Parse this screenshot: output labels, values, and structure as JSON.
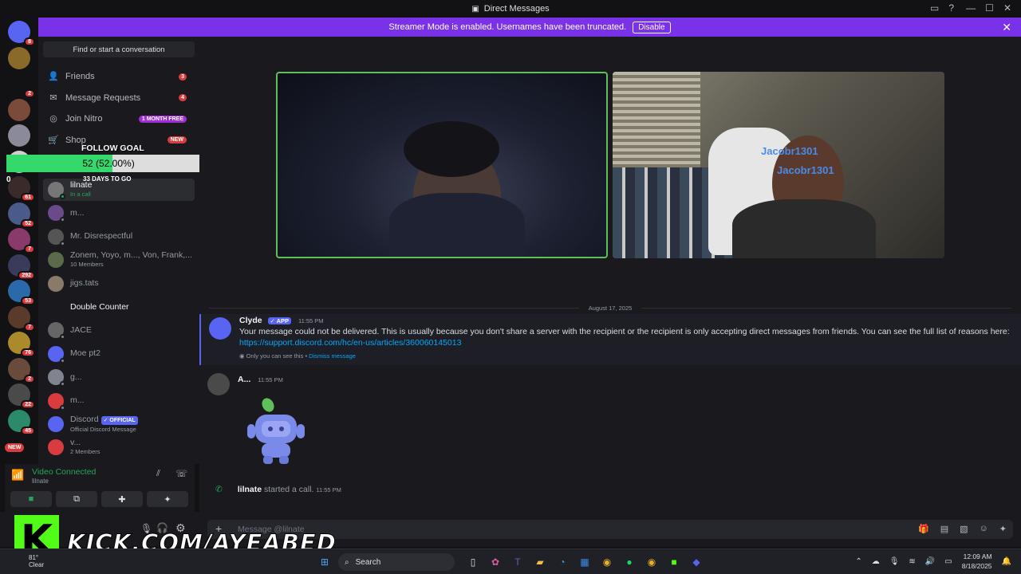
{
  "window": {
    "title": "Direct Messages"
  },
  "banner": {
    "text": "Streamer Mode is enabled. Usernames have been truncated.",
    "button": "Disable"
  },
  "servers": [
    {
      "badge": "8",
      "color": "#5865f2"
    },
    {
      "badge": "",
      "color": "#8a6a2a"
    },
    {
      "badge": "2",
      "color": "#121214"
    },
    {
      "badge": "",
      "color": "#7a4a3a"
    },
    {
      "badge": "",
      "color": "#8a8a9a"
    },
    {
      "badge": "",
      "color": "#cfcfcf"
    },
    {
      "badge": "61",
      "color": "#3a2a2a"
    },
    {
      "badge": "52",
      "color": "#4a5a8a"
    },
    {
      "badge": "7",
      "color": "#8a3a6a"
    },
    {
      "badge": "292",
      "color": "#3a3a5a"
    },
    {
      "badge": "53",
      "color": "#2a6aaa"
    },
    {
      "badge": "7",
      "color": "#5a3a2a"
    },
    {
      "badge": "76",
      "color": "#aa8a2a"
    },
    {
      "badge": "2",
      "color": "#6a4a3a"
    },
    {
      "badge": "22",
      "color": "#4a4a4a"
    },
    {
      "badge": "45",
      "color": "#2a8a6a"
    }
  ],
  "servers_new": "NEW",
  "sidebar": {
    "find": "Find or start a conversation",
    "nav": [
      {
        "label": "Friends",
        "badge": "3",
        "icon": "friends-icon"
      },
      {
        "label": "Message Requests",
        "badge": "4",
        "icon": "mail-icon"
      },
      {
        "label": "Join Nitro",
        "badge": "1 MONTH FREE",
        "icon": "nitro-icon"
      },
      {
        "label": "Shop",
        "badge": "NEW",
        "icon": "shop-icon"
      }
    ],
    "dms": [
      {
        "name": "lilnate",
        "sub": "In a call",
        "color": "#777",
        "status": "#23a55a"
      },
      {
        "name": "m...",
        "sub": "",
        "color": "#6a4a8a",
        "status": "#80848e"
      },
      {
        "name": "Mr. Disrespectful",
        "sub": "",
        "color": "#555",
        "status": "#80848e"
      },
      {
        "name": "Zonem, Yoyo, m..., Von, Frank,...",
        "sub": "10 Members",
        "color": "#5a6a4a",
        "status": ""
      },
      {
        "name": "jigs.tats",
        "sub": "",
        "color": "#8a7a6a",
        "status": ""
      },
      {
        "name": "Double Counter",
        "sub": "",
        "color": "#1a1a1e",
        "status": ""
      },
      {
        "name": "JACE",
        "sub": "",
        "color": "#666",
        "status": "#80848e"
      },
      {
        "name": "Moe pt2",
        "sub": "",
        "color": "#5865f2",
        "status": "#80848e"
      },
      {
        "name": "g...",
        "sub": "",
        "color": "#80848e",
        "status": "#80848e"
      },
      {
        "name": "m...",
        "sub": "",
        "color": "#d83c3e",
        "status": "#80848e"
      },
      {
        "name": "Discord",
        "sub": "Official Discord Message",
        "color": "#5865f2",
        "status": "",
        "tag": "OFFICIAL"
      },
      {
        "name": "v...",
        "sub": "2 Members",
        "color": "#d83c3e",
        "status": ""
      }
    ]
  },
  "follow_goal": {
    "title": "FOLLOW GOAL",
    "value": "52 (52.00%)",
    "progress": 0.52,
    "min": "0",
    "max": "100",
    "days": "33 DAYS TO GO"
  },
  "voice": {
    "status": "Video Connected",
    "user": "lilnate"
  },
  "call": {
    "overlay1": "Jacobr1301",
    "overlay2": "Jacobr1301"
  },
  "chat": {
    "date": "August 17, 2025",
    "messages": [
      {
        "author": "Clyde",
        "tag": "APP",
        "time": "11:55 PM",
        "text": "Your message could not be delivered. This is usually because you don't share a server with the recipient or the recipient is only accepting direct messages from friends. You can see the full list of reasons here:",
        "link": "https://support.discord.com/hc/en-us/articles/360060145013",
        "note": "Only you can see this",
        "dismiss": "Dismiss message"
      },
      {
        "author": "A...",
        "time": "11:55 PM"
      }
    ],
    "call_event": {
      "user": "lilnate",
      "text": "started a call.",
      "time": "11:55 PM"
    },
    "composer_placeholder": "Message @lilnate"
  },
  "kick": {
    "logo": "K",
    "url": "KICK.COM/AYEABED"
  },
  "taskbar": {
    "search": "Search",
    "time": "12:09 AM",
    "date": "8/18/2025",
    "weather": "81°",
    "weather_text": "Clear"
  }
}
